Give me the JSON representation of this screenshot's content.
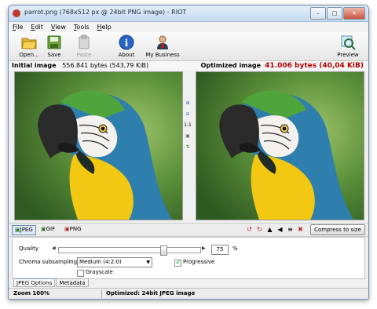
{
  "window": {
    "title": "parrot.png (768x512 px @ 24bit PNG image) - RIOT"
  },
  "menu": [
    {
      "u": "F",
      "rest": "ile"
    },
    {
      "u": "E",
      "rest": "dit"
    },
    {
      "u": "V",
      "rest": "iew"
    },
    {
      "u": "T",
      "rest": "ools"
    },
    {
      "u": "H",
      "rest": "elp"
    }
  ],
  "toolbar": {
    "open": "Open...",
    "save": "Save",
    "paste": "Paste",
    "about": "About",
    "business": "My Business",
    "preview": "Preview"
  },
  "images": {
    "initial_label": "Initial image",
    "initial_size": "556.841 bytes (543,79 KiB)",
    "optimized_label": "Optimized image",
    "optimized_size": "41.006 bytes (40,04 KiB)"
  },
  "zoom_tools": {
    "one_to_one": "1:1"
  },
  "formats": {
    "jpeg": "JPEG",
    "gif": "GIF",
    "png": "PNG",
    "selected": "JPEG"
  },
  "compress_label": "Compress to size",
  "options": {
    "quality_label": "Quality",
    "quality_value": "75",
    "quality_unit": "%",
    "quality_fraction": 0.75,
    "chroma_label": "Chroma subsampling",
    "chroma_value": "Medium (4:2:0)",
    "progressive_label": "Progressive",
    "progressive_checked": true,
    "grayscale_label": "Grayscale",
    "grayscale_checked": false
  },
  "bottom_tabs": [
    "JPEG Options",
    "Metadata"
  ],
  "status": {
    "zoom": "Zoom 100%",
    "info": "Optimized: 24bit JPEG image"
  },
  "colors": {
    "accent_red": "#b10000",
    "parrot_yellow": "#f2c813",
    "parrot_blue": "#2f7fae",
    "background_green": "#4d7d3a"
  }
}
